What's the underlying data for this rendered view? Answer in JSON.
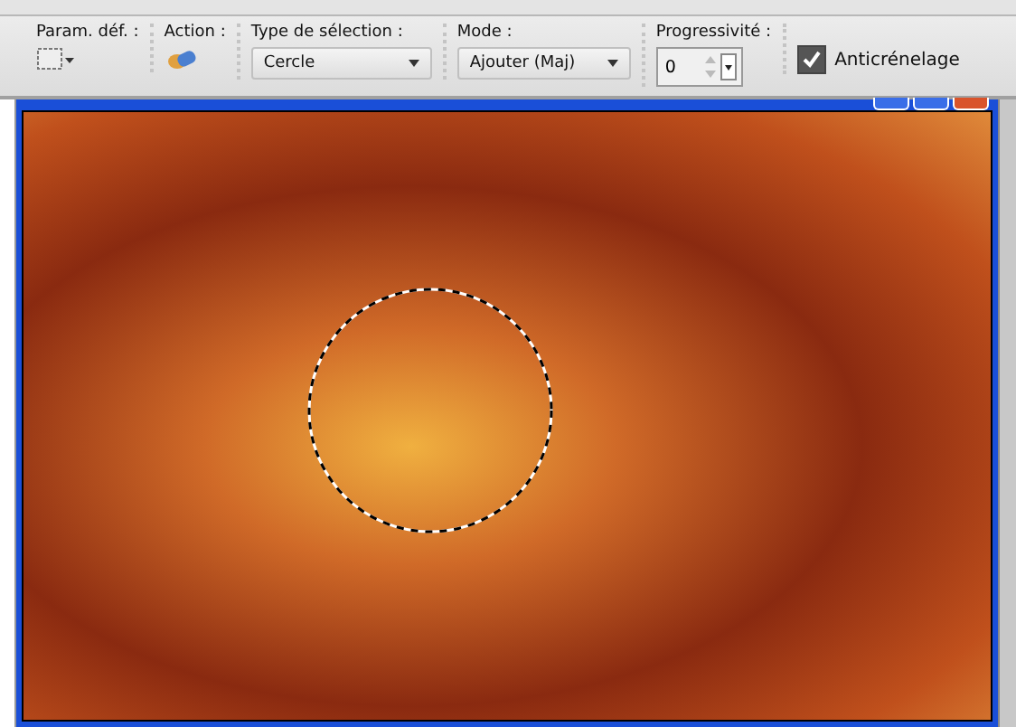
{
  "toolbar": {
    "groups": [
      {
        "kind": "preset",
        "label": "Param. déf. :"
      },
      {
        "kind": "action",
        "label": "Action :"
      },
      {
        "kind": "dropdown",
        "label": "Type de sélection :",
        "value": "Cercle"
      },
      {
        "kind": "dropdown",
        "label": "Mode :",
        "value": "Ajouter (Maj)"
      },
      {
        "kind": "spinner",
        "label": "Progressivité :",
        "value": "0"
      },
      {
        "kind": "checkbox",
        "label": "Anticrénelage",
        "checked": true
      }
    ]
  }
}
